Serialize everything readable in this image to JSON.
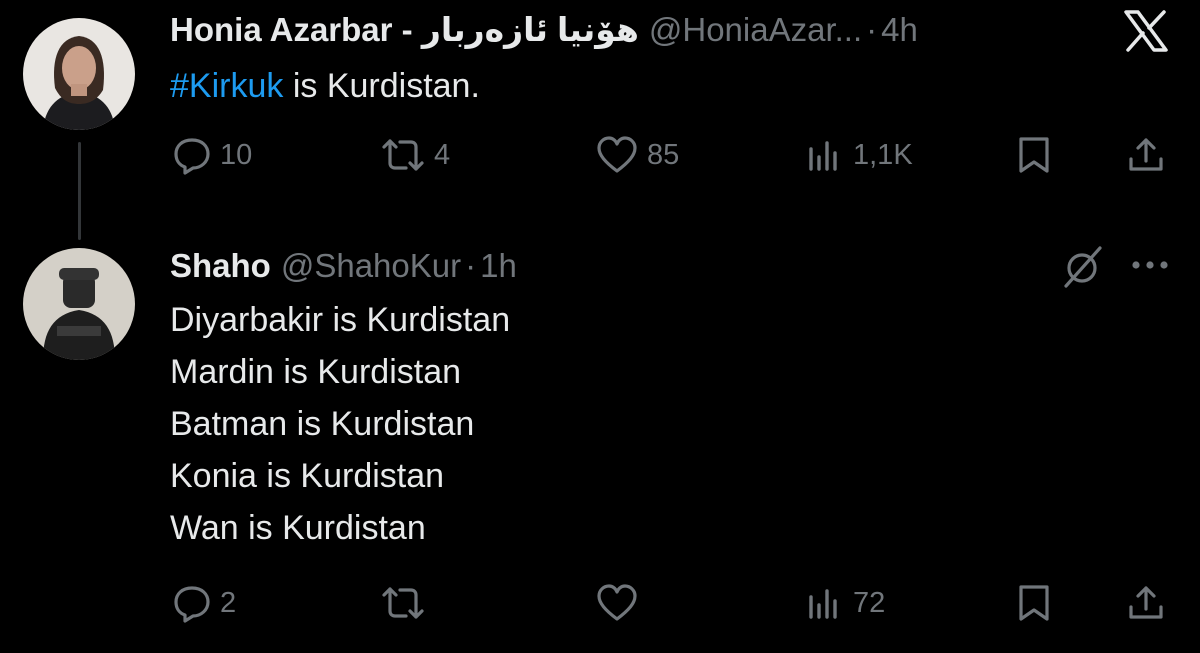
{
  "tweet": {
    "author_name": "Honia Azarbar - هۆنیا ئازەربار",
    "handle": "@HoniaAzar...",
    "dot": "·",
    "time": "4h",
    "hashtag": "#Kirkuk",
    "text_rest": " is Kurdistan.",
    "actions": {
      "replies": "10",
      "retweets": "4",
      "likes": "85",
      "views": "1,1K"
    }
  },
  "reply": {
    "author_name": "Shaho",
    "handle": "@ShahoKur",
    "dot": "·",
    "time": "1h",
    "lines": [
      "Diyarbakir is Kurdistan",
      "Mardin is Kurdistan",
      "Batman is Kurdistan",
      "Konia is Kurdistan",
      "Wan is Kurdistan"
    ],
    "actions": {
      "replies": "2",
      "retweets": "",
      "likes": "",
      "views": "72"
    }
  },
  "icons": {
    "x_logo": "x-logo-icon",
    "reply": "reply-icon",
    "retweet": "retweet-icon",
    "like": "heart-icon",
    "views": "views-icon",
    "bookmark": "bookmark-icon",
    "share": "share-icon",
    "grok": "grok-icon",
    "more": "more-icon"
  },
  "colors": {
    "background": "#000000",
    "text": "#e7e9ea",
    "secondary": "#71767b",
    "link": "#1d9bf0"
  }
}
